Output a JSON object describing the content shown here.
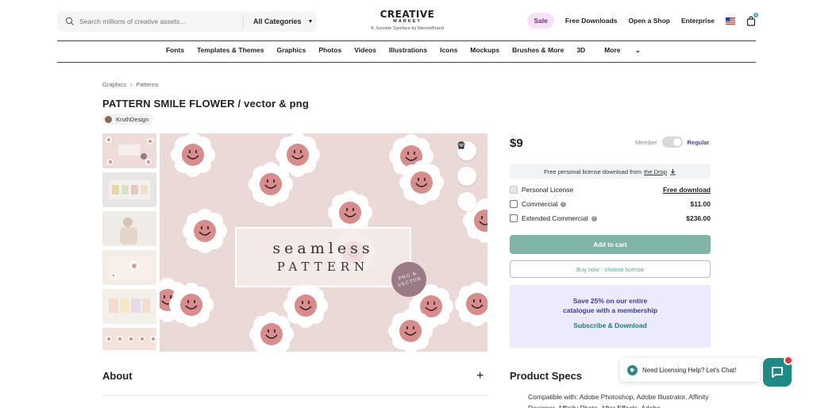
{
  "header": {
    "search_placeholder": "Search millions of creative assets...",
    "categories_label": "All Categories",
    "logo_main": "CREATIVE",
    "logo_sub": "MARKET",
    "logo_credit": "ft. Sunside Typeface by NienowBrand",
    "nav": [
      "Sale",
      "Free Downloads",
      "Open a Shop",
      "Enterprise"
    ],
    "cart_count": "0"
  },
  "category_nav": [
    "Fonts",
    "Templates & Themes",
    "Graphics",
    "Photos",
    "Videos",
    "Illustrations",
    "Icons",
    "Mockups",
    "Brushes & More",
    "3D",
    "More"
  ],
  "breadcrumb": [
    "Graphics",
    "Patterns"
  ],
  "product": {
    "title": "PATTERN SMILE FLOWER / vector & png",
    "author": "KruthDesign",
    "image_text_1": "seamless",
    "image_text_2": "PATTERN",
    "image_badge": "PNG & VECTOR"
  },
  "about_label": "About",
  "pricing": {
    "price": "$9",
    "member_label": "Member",
    "regular_label": "Regular",
    "free_license_text": "Free personal license download from",
    "free_license_link": "the Drop",
    "licenses": [
      {
        "name": "Personal License",
        "price": "Free download"
      },
      {
        "name": "Commercial",
        "price": "$11.00"
      },
      {
        "name": "Extended Commercial",
        "price": "$236.00"
      }
    ],
    "add_to_cart": "Add to cart",
    "buy_now": "Buy now - choose license"
  },
  "membership": {
    "line1": "Save 25% on our entire",
    "line2": "catalogue with a membership",
    "cta": "Subscribe & Download"
  },
  "specs": {
    "title": "Product Specs",
    "compat": "Compatible with: Adobe Photoshop, Adobe Illustrator, Affinity Designer, Affinity Photo, After Effects, Adobe"
  },
  "chat": {
    "prompt": "Need Licensing Help? Let's Chat!"
  },
  "colors": {
    "accent": "#7fb5a6",
    "membership_bg": "#eceafd",
    "pattern_bg": "#ead9d6",
    "flower_center": "#d98c8c"
  }
}
